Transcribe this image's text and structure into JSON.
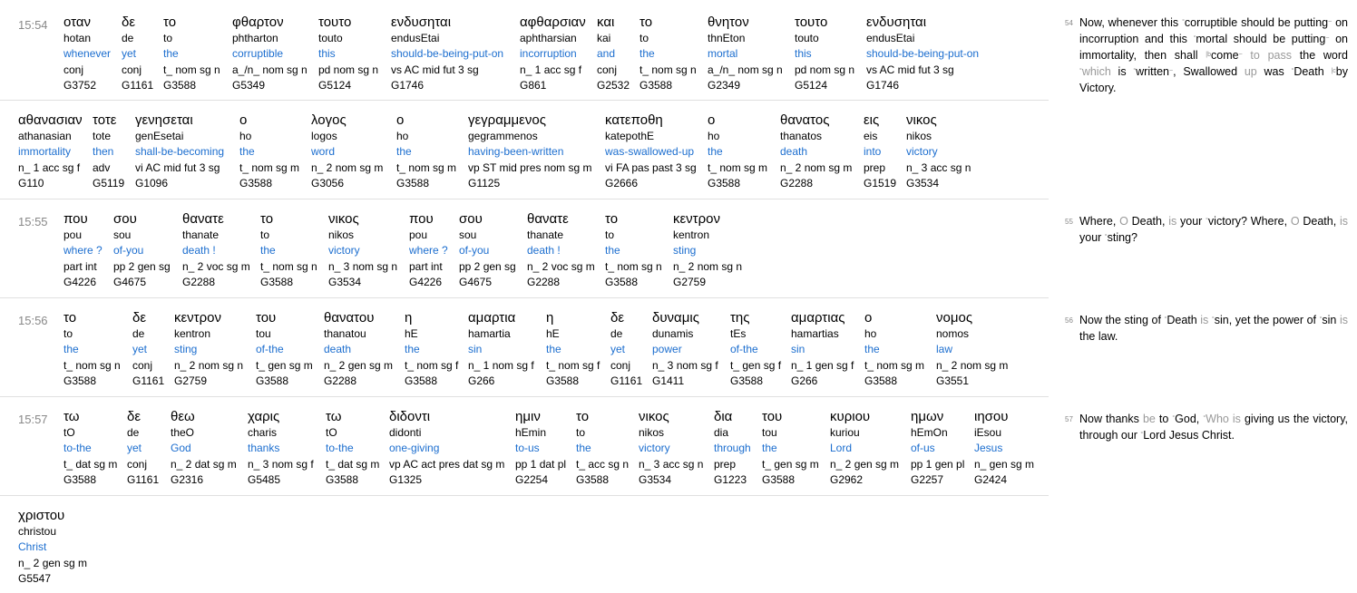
{
  "rows": [
    {
      "ref": "15:54",
      "words": [
        {
          "greek": "οταν",
          "translit": "hotan",
          "translit_italic": "h",
          "gloss": "whenever",
          "morph": "conj",
          "strong": "G3752"
        },
        {
          "greek": "δε",
          "translit": "de",
          "gloss": "yet",
          "morph": "conj",
          "strong": "G1161"
        },
        {
          "greek": "το",
          "translit": "to",
          "gloss": "the",
          "morph": "t_ nom sg n",
          "strong": "G3588"
        },
        {
          "greek": "φθαρτον",
          "translit": "phtharton",
          "gloss": "corruptible",
          "morph": "a_/n_ nom sg n",
          "strong": "G5349"
        },
        {
          "greek": "τουτο",
          "translit": "touto",
          "gloss": "this",
          "morph": "pd nom sg n",
          "strong": "G5124"
        },
        {
          "greek": "ενδυσηται",
          "translit": "endusEtai",
          "gloss": "should-be-being-put-on",
          "morph": "vs AC mid fut 3 sg",
          "strong": "G1746"
        },
        {
          "greek": "αφθαρσιαν",
          "translit": "aphtharsian",
          "gloss": "incorruption",
          "morph": "n_ 1 acc sg f",
          "strong": "G861"
        },
        {
          "greek": "και",
          "translit": "kai",
          "gloss": "and",
          "morph": "conj",
          "strong": "G2532"
        },
        {
          "greek": "το",
          "translit": "to",
          "gloss": "the",
          "morph": "t_ nom sg n",
          "strong": "G3588"
        },
        {
          "greek": "θνητον",
          "translit": "thnEton",
          "gloss": "mortal",
          "morph": "a_/n_ nom sg n",
          "strong": "G2349"
        },
        {
          "greek": "τουτο",
          "translit": "touto",
          "gloss": "this",
          "morph": "pd nom sg n",
          "strong": "G5124"
        },
        {
          "greek": "ενδυσηται",
          "translit": "endusEtai",
          "gloss": "should-be-being-put-on",
          "morph": "vs AC mid fut 3 sg",
          "strong": "G1746"
        }
      ]
    },
    {
      "ref": "",
      "words": [
        {
          "greek": "αθανασιαν",
          "translit": "athanasian",
          "gloss": "immortality",
          "morph": "n_ 1 acc sg f",
          "strong": "G110"
        },
        {
          "greek": "τοτε",
          "translit": "tote",
          "gloss": "then",
          "morph": "adv",
          "strong": "G5119"
        },
        {
          "greek": "γενησεται",
          "translit": "genEsetai",
          "gloss": "shall-be-becoming",
          "morph": "vi AC mid fut 3 sg",
          "strong": "G1096"
        },
        {
          "greek": "ο",
          "translit": "ho",
          "gloss": "the",
          "morph": "t_ nom sg m",
          "strong": "G3588"
        },
        {
          "greek": "λογος",
          "translit": "logos",
          "gloss": "word",
          "morph": "n_ 2 nom sg m",
          "strong": "G3056"
        },
        {
          "greek": "ο",
          "translit": "ho",
          "gloss": "the",
          "morph": "t_ nom sg m",
          "strong": "G3588"
        },
        {
          "greek": "γεγραμμενος",
          "translit": "gegrammenos",
          "gloss": "having-been-written",
          "morph": "vp ST mid pres nom sg m",
          "strong": "G1125"
        },
        {
          "greek": "κατεποθη",
          "translit": "katepothE",
          "gloss": "was-swallowed-up",
          "morph": "vi FA pas past 3 sg",
          "strong": "G2666"
        },
        {
          "greek": "ο",
          "translit": "ho",
          "gloss": "the",
          "morph": "t_ nom sg m",
          "strong": "G3588"
        },
        {
          "greek": "θανατος",
          "translit": "thanatos",
          "gloss": "death",
          "morph": "n_ 2 nom sg m",
          "strong": "G2288"
        },
        {
          "greek": "εις",
          "translit": "eis",
          "gloss": "into",
          "morph": "prep",
          "strong": "G1519"
        },
        {
          "greek": "νικος",
          "translit": "nikos",
          "gloss": "victory",
          "morph": "n_ 3 acc sg n",
          "strong": "G3534"
        }
      ]
    },
    {
      "ref": "15:55",
      "words": [
        {
          "greek": "που",
          "translit": "pou",
          "gloss": "where ?",
          "morph": "part int",
          "strong": "G4226"
        },
        {
          "greek": "σου",
          "translit": "sou",
          "gloss": "of-you",
          "morph": "pp 2 gen sg",
          "strong": "G4675"
        },
        {
          "greek": "θανατε",
          "translit": "thanate",
          "gloss": "death !",
          "morph": "n_ 2 voc sg m",
          "strong": "G2288"
        },
        {
          "greek": "το",
          "translit": "to",
          "gloss": "the",
          "morph": "t_ nom sg n",
          "strong": "G3588"
        },
        {
          "greek": "νικος",
          "translit": "nikos",
          "gloss": "victory",
          "morph": "n_ 3 nom sg n",
          "strong": "G3534"
        },
        {
          "greek": "που",
          "translit": "pou",
          "gloss": "where ?",
          "morph": "part int",
          "strong": "G4226"
        },
        {
          "greek": "σου",
          "translit": "sou",
          "gloss": "of-you",
          "morph": "pp 2 gen sg",
          "strong": "G4675"
        },
        {
          "greek": "θανατε",
          "translit": "thanate",
          "gloss": "death !",
          "morph": "n_ 2 voc sg m",
          "strong": "G2288"
        },
        {
          "greek": "το",
          "translit": "to",
          "gloss": "the",
          "morph": "t_ nom sg n",
          "strong": "G3588"
        },
        {
          "greek": "κεντρον",
          "translit": "kentron",
          "gloss": "sting",
          "morph": "n_ 2 nom sg n",
          "strong": "G2759"
        }
      ]
    },
    {
      "ref": "15:56",
      "words": [
        {
          "greek": "το",
          "translit": "to",
          "gloss": "the",
          "morph": "t_ nom sg n",
          "strong": "G3588"
        },
        {
          "greek": "δε",
          "translit": "de",
          "gloss": "yet",
          "morph": "conj",
          "strong": "G1161"
        },
        {
          "greek": "κεντρον",
          "translit": "kentron",
          "gloss": "sting",
          "morph": "n_ 2 nom sg n",
          "strong": "G2759"
        },
        {
          "greek": "του",
          "translit": "tou",
          "gloss": "of-the",
          "morph": "t_ gen sg m",
          "strong": "G3588"
        },
        {
          "greek": "θανατου",
          "translit": "thanatou",
          "gloss": "death",
          "morph": "n_ 2 gen sg m",
          "strong": "G2288"
        },
        {
          "greek": "η",
          "translit": "hE",
          "gloss": "the",
          "morph": "t_ nom sg f",
          "strong": "G3588"
        },
        {
          "greek": "αμαρτια",
          "translit": "hamartia",
          "gloss": "sin",
          "morph": "n_ 1 nom sg f",
          "strong": "G266"
        },
        {
          "greek": "η",
          "translit": "hE",
          "gloss": "the",
          "morph": "t_ nom sg f",
          "strong": "G3588"
        },
        {
          "greek": "δε",
          "translit": "de",
          "gloss": "yet",
          "morph": "conj",
          "strong": "G1161"
        },
        {
          "greek": "δυναμις",
          "translit": "dunamis",
          "gloss": "power",
          "morph": "n_ 3 nom sg f",
          "strong": "G1411"
        },
        {
          "greek": "της",
          "translit": "tEs",
          "gloss": "of-the",
          "morph": "t_ gen sg f",
          "strong": "G3588"
        },
        {
          "greek": "αμαρτιας",
          "translit": "hamartias",
          "gloss": "sin",
          "morph": "n_ 1 gen sg f",
          "strong": "G266"
        },
        {
          "greek": "ο",
          "translit": "ho",
          "gloss": "the",
          "morph": "t_ nom sg m",
          "strong": "G3588"
        },
        {
          "greek": "νομος",
          "translit": "nomos",
          "gloss": "law",
          "morph": "n_ 2 nom sg m",
          "strong": "G3551"
        }
      ]
    },
    {
      "ref": "15:57",
      "words": [
        {
          "greek": "τω",
          "translit": "tO",
          "gloss": "to-the",
          "morph": "t_ dat sg m",
          "strong": "G3588"
        },
        {
          "greek": "δε",
          "translit": "de",
          "gloss": "yet",
          "morph": "conj",
          "strong": "G1161"
        },
        {
          "greek": "θεω",
          "translit": "theO",
          "gloss": "God",
          "morph": "n_ 2 dat sg m",
          "strong": "G2316"
        },
        {
          "greek": "χαρις",
          "translit": "charis",
          "gloss": "thanks",
          "morph": "n_ 3 nom sg f",
          "strong": "G5485"
        },
        {
          "greek": "τω",
          "translit": "tO",
          "gloss": "to-the",
          "morph": "t_ dat sg m",
          "strong": "G3588"
        },
        {
          "greek": "διδοντι",
          "translit": "didonti",
          "gloss": "one-giving",
          "morph": "vp AC act pres dat sg m",
          "strong": "G1325"
        },
        {
          "greek": "ημιν",
          "translit": "hEmin",
          "gloss": "to-us",
          "morph": "pp 1 dat pl",
          "strong": "G2254"
        },
        {
          "greek": "το",
          "translit": "to",
          "gloss": "the",
          "morph": "t_ acc sg n",
          "strong": "G3588"
        },
        {
          "greek": "νικος",
          "translit": "nikos",
          "gloss": "victory",
          "morph": "n_ 3 acc sg n",
          "strong": "G3534"
        },
        {
          "greek": "δια",
          "translit": "dia",
          "gloss": "through",
          "morph": "prep",
          "strong": "G1223"
        },
        {
          "greek": "του",
          "translit": "tou",
          "gloss": "the",
          "morph": "t_ gen sg m",
          "strong": "G3588"
        },
        {
          "greek": "κυριου",
          "translit": "kuriou",
          "gloss": "Lord",
          "morph": "n_ 2 gen sg m",
          "strong": "G2962"
        },
        {
          "greek": "ημων",
          "translit": "hEmOn",
          "gloss": "of-us",
          "morph": "pp 1 gen pl",
          "strong": "G2257"
        },
        {
          "greek": "ιησου",
          "translit": "iEsou",
          "gloss": "Jesus",
          "morph": "n_ gen sg m",
          "strong": "G2424"
        }
      ]
    },
    {
      "ref": "",
      "words": [
        {
          "greek": "χριστου",
          "translit": "christou",
          "gloss": "Christ",
          "morph": "n_ 2 gen sg m",
          "strong": "G5547"
        }
      ]
    }
  ],
  "verses": [
    {
      "num": "54",
      "segments": [
        {
          "t": "Now, whenever this ",
          "c": ""
        },
        {
          "t": "°",
          "c": "sup"
        },
        {
          "t": "corruptible should be putting",
          "c": ""
        },
        {
          "t": "~",
          "c": "sup"
        },
        {
          "t": " on incorruption and this ",
          "c": ""
        },
        {
          "t": "°",
          "c": "sup"
        },
        {
          "t": "mortal should be putting",
          "c": ""
        },
        {
          "t": "~",
          "c": "sup"
        },
        {
          "t": " on immortality, then shall ",
          "c": ""
        },
        {
          "t": "|b",
          "c": "sup"
        },
        {
          "t": "come",
          "c": ""
        },
        {
          "t": "~",
          "c": "sup"
        },
        {
          "t": " to pass",
          "c": "gray"
        },
        {
          "t": " the word ",
          "c": ""
        },
        {
          "t": "°",
          "c": "sup"
        },
        {
          "t": "which",
          "c": "gray"
        },
        {
          "t": " is ",
          "c": ""
        },
        {
          "t": "°",
          "c": "sup"
        },
        {
          "t": "written",
          "c": ""
        },
        {
          "t": "~",
          "c": "sup"
        },
        {
          "t": ", Swallowed ",
          "c": ""
        },
        {
          "t": "up",
          "c": "gray"
        },
        {
          "t": " was ",
          "c": ""
        },
        {
          "t": "°",
          "c": "sup"
        },
        {
          "t": "Death ",
          "c": ""
        },
        {
          "t": "|c",
          "c": "sup"
        },
        {
          "t": "by Victory.",
          "c": ""
        }
      ]
    },
    {
      "num": "55",
      "segments": [
        {
          "t": "Where, ",
          "c": ""
        },
        {
          "t": "O",
          "c": "gray"
        },
        {
          "t": " Death, ",
          "c": ""
        },
        {
          "t": "is",
          "c": "gray"
        },
        {
          "t": " your ",
          "c": ""
        },
        {
          "t": "°",
          "c": "sup"
        },
        {
          "t": "victory? Where, ",
          "c": ""
        },
        {
          "t": "O",
          "c": "gray"
        },
        {
          "t": " Death, ",
          "c": ""
        },
        {
          "t": "is",
          "c": "gray"
        },
        {
          "t": " your ",
          "c": ""
        },
        {
          "t": "°",
          "c": "sup"
        },
        {
          "t": "sting?",
          "c": ""
        }
      ]
    },
    {
      "num": "56",
      "segments": [
        {
          "t": "Now the sting of ",
          "c": ""
        },
        {
          "t": "°",
          "c": "sup"
        },
        {
          "t": "Death ",
          "c": ""
        },
        {
          "t": "is",
          "c": "gray"
        },
        {
          "t": " ",
          "c": ""
        },
        {
          "t": "°",
          "c": "sup"
        },
        {
          "t": "sin, yet the power of ",
          "c": ""
        },
        {
          "t": "°",
          "c": "sup"
        },
        {
          "t": "sin ",
          "c": ""
        },
        {
          "t": "is",
          "c": "gray"
        },
        {
          "t": " the law.",
          "c": ""
        }
      ]
    },
    {
      "num": "57",
      "segments": [
        {
          "t": "Now thanks ",
          "c": ""
        },
        {
          "t": "be",
          "c": "gray"
        },
        {
          "t": " to ",
          "c": ""
        },
        {
          "t": "°",
          "c": "sup"
        },
        {
          "t": "God, ",
          "c": ""
        },
        {
          "t": "°",
          "c": "sup"
        },
        {
          "t": "Who",
          "c": "gray"
        },
        {
          "t": " ",
          "c": ""
        },
        {
          "t": "is",
          "c": "gray"
        },
        {
          "t": " giving us the victory, through our ",
          "c": ""
        },
        {
          "t": "°",
          "c": "sup"
        },
        {
          "t": "Lord Jesus Christ.",
          "c": ""
        }
      ]
    }
  ]
}
